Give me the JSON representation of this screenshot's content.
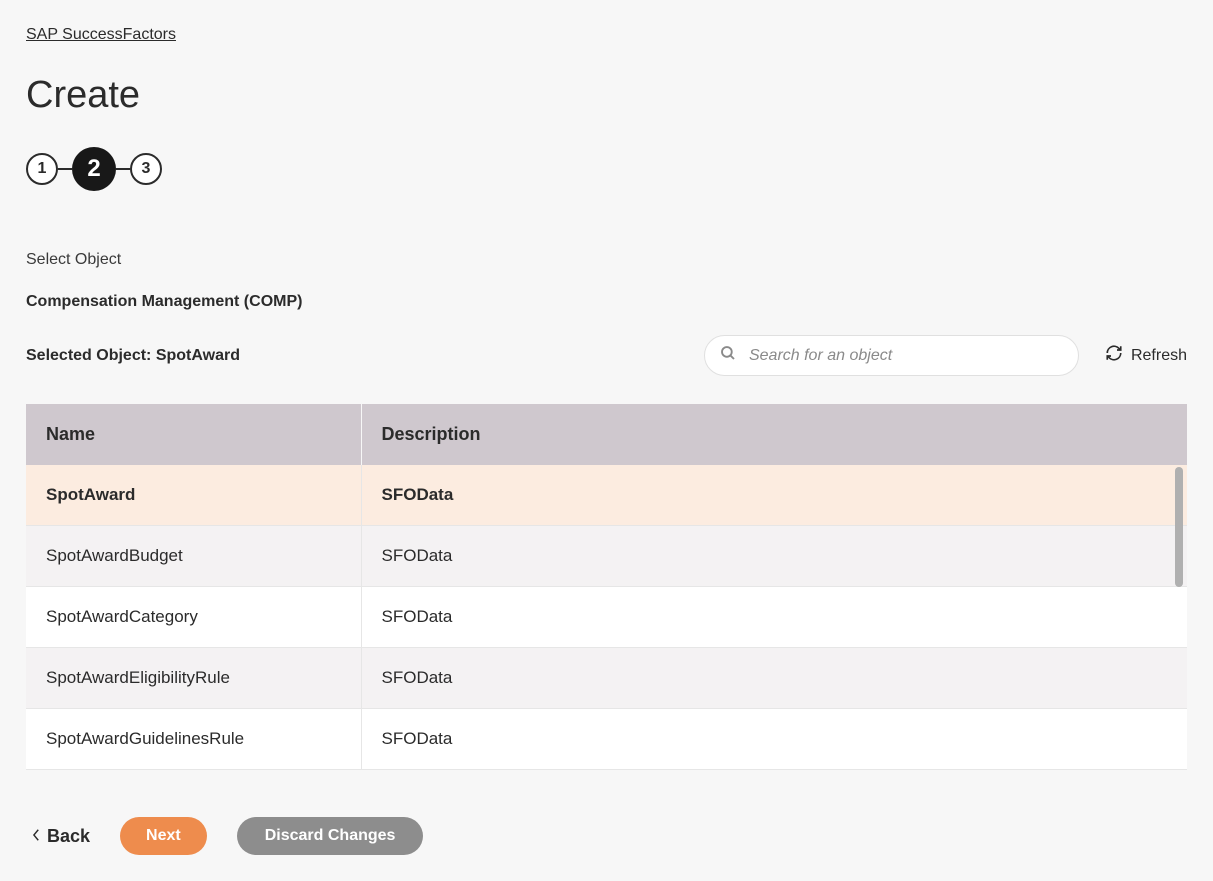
{
  "breadcrumb": "SAP SuccessFactors",
  "page_title": "Create",
  "steps": [
    "1",
    "2",
    "3"
  ],
  "active_step_index": 1,
  "section_label": "Select Object",
  "module_label": "Compensation Management (COMP)",
  "selected_object_label": "Selected Object: SpotAward",
  "search": {
    "placeholder": "Search for an object"
  },
  "refresh_label": "Refresh",
  "table": {
    "headers": {
      "name": "Name",
      "description": "Description"
    },
    "rows": [
      {
        "name": "SpotAward",
        "description": "SFOData",
        "selected": true
      },
      {
        "name": "SpotAwardBudget",
        "description": "SFOData",
        "selected": false
      },
      {
        "name": "SpotAwardCategory",
        "description": "SFOData",
        "selected": false
      },
      {
        "name": "SpotAwardEligibilityRule",
        "description": "SFOData",
        "selected": false
      },
      {
        "name": "SpotAwardGuidelinesRule",
        "description": "SFOData",
        "selected": false
      }
    ]
  },
  "footer": {
    "back": "Back",
    "next": "Next",
    "discard": "Discard Changes"
  }
}
